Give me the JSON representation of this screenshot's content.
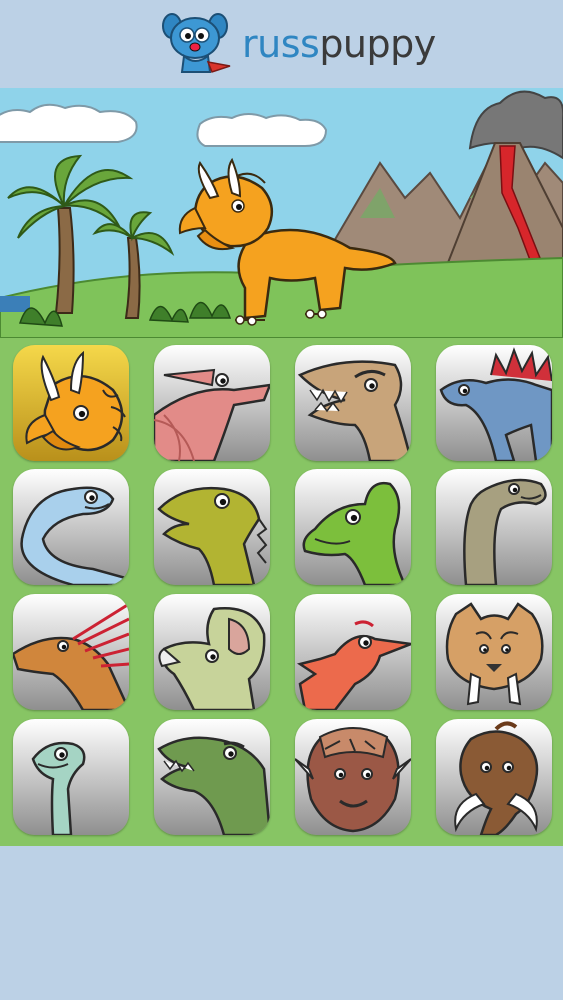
{
  "brand": {
    "part1": "russ",
    "part2": "puppy"
  },
  "scene": {
    "featured": "triceratops"
  },
  "animals": [
    {
      "name": "triceratops",
      "icon": "triceratops-icon",
      "color": "#f5a21f",
      "selected": true
    },
    {
      "name": "pteranodon",
      "icon": "pteranodon-icon",
      "color": "#e28b88"
    },
    {
      "name": "tyrannosaurus",
      "icon": "tyrannosaurus-icon",
      "color": "#c8a47a"
    },
    {
      "name": "stegosaurus",
      "icon": "stegosaurus-icon",
      "color": "#6f97c4"
    },
    {
      "name": "diplodocus",
      "icon": "diplodocus-icon",
      "color": "#a9d0ec"
    },
    {
      "name": "iguanodon",
      "icon": "iguanodon-icon",
      "color": "#b2b432"
    },
    {
      "name": "parasaurolophus",
      "icon": "parasaurolophus-icon",
      "color": "#7cbf3c"
    },
    {
      "name": "brachiosaurus",
      "icon": "brachiosaurus-icon",
      "color": "#a7a080"
    },
    {
      "name": "dimetrodon",
      "icon": "dimetrodon-icon",
      "color": "#d0863c"
    },
    {
      "name": "protoceratops",
      "icon": "protoceratops-icon",
      "color": "#c7d39a"
    },
    {
      "name": "archaeopteryx",
      "icon": "archaeopteryx-icon",
      "color": "#ec6a4c"
    },
    {
      "name": "sabertooth-tiger",
      "icon": "sabertooth-tiger-icon",
      "color": "#d6a066"
    },
    {
      "name": "plesiosaur",
      "icon": "plesiosaur-icon",
      "color": "#a5d4c4"
    },
    {
      "name": "crocodile",
      "icon": "crocodile-icon",
      "color": "#6f9a4f"
    },
    {
      "name": "ankylosaurus",
      "icon": "ankylosaurus-icon",
      "color": "#9b5846"
    },
    {
      "name": "mammoth",
      "icon": "mammoth-icon",
      "color": "#8a5a35"
    }
  ]
}
